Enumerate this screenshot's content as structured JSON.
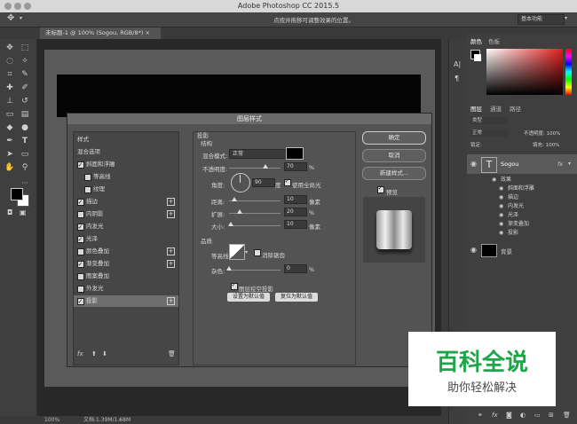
{
  "app": {
    "title": "Adobe Photoshop CC 2015.5"
  },
  "options_bar": {
    "hint": "点按并拖移可调整效果的位置。",
    "workspace": "基本功能"
  },
  "document": {
    "tab": "未标题-1 @ 100% (Sogou, RGB/8*) ×"
  },
  "status": {
    "zoom": "100%",
    "doc_info": "文档:1.39M/1.68M"
  },
  "right_panels": {
    "top_tabs": [
      "颜色",
      "色板"
    ],
    "layer_tabs": [
      "图层",
      "通道",
      "路径"
    ],
    "filter_label": "类型",
    "blend_mode": "正常",
    "opacity_label": "不透明度: 100%",
    "lock_label": "锁定:",
    "fill_label": "填充: 100%",
    "text_layer_name": "Sogou",
    "effects_label": "效果",
    "effects": [
      "斜面和浮雕",
      "描边",
      "内发光",
      "光泽",
      "渐变叠加",
      "投影"
    ],
    "background_layer": "背景"
  },
  "dialog": {
    "title": "图层样式",
    "styles_header": "样式",
    "blend_options": "混合选项",
    "style_items": [
      {
        "label": "斜面和浮雕",
        "checked": true,
        "plus": false,
        "indent": false
      },
      {
        "label": "等高线",
        "checked": false,
        "plus": false,
        "indent": true
      },
      {
        "label": "纹理",
        "checked": false,
        "plus": false,
        "indent": true
      },
      {
        "label": "描边",
        "checked": true,
        "plus": true,
        "indent": false
      },
      {
        "label": "内阴影",
        "checked": false,
        "plus": true,
        "indent": false
      },
      {
        "label": "内发光",
        "checked": true,
        "plus": false,
        "indent": false
      },
      {
        "label": "光泽",
        "checked": true,
        "plus": false,
        "indent": false
      },
      {
        "label": "颜色叠加",
        "checked": false,
        "plus": true,
        "indent": false
      },
      {
        "label": "渐变叠加",
        "checked": true,
        "plus": true,
        "indent": false
      },
      {
        "label": "图案叠加",
        "checked": false,
        "plus": false,
        "indent": false
      },
      {
        "label": "外发光",
        "checked": false,
        "plus": false,
        "indent": false
      },
      {
        "label": "投影",
        "checked": true,
        "plus": true,
        "indent": false
      }
    ],
    "section_title": "投影",
    "structure_label": "结构",
    "blend_mode_label": "混合模式:",
    "blend_mode_value": "正常",
    "opacity_label": "不透明度:",
    "opacity_value": "70",
    "opacity_pct": 0.7,
    "angle_label": "角度:",
    "angle_value": "90",
    "angle_unit": "度",
    "global_light_label": "使用全局光",
    "distance_label": "距离:",
    "distance_value": "10",
    "distance_pct": 0.1,
    "spread_label": "扩展:",
    "spread_value": "20",
    "spread_pct": 0.2,
    "size_label": "大小:",
    "size_value": "10",
    "size_pct": 0.04,
    "px_unit": "像素",
    "pct_unit": "%",
    "quality_label": "品质",
    "contour_label": "等高线:",
    "antialias_label": "消除锯齿",
    "noise_label": "杂色:",
    "noise_value": "0",
    "noise_pct": 0,
    "knockout_label": "图层挖空投影",
    "default_btn": "设置为默认值",
    "reset_btn": "复位为默认值",
    "ok": "确定",
    "cancel": "取消",
    "new_style": "新建样式...",
    "preview": "预览"
  },
  "watermark": {
    "big": "百科全说",
    "small": "助你轻松解决"
  }
}
